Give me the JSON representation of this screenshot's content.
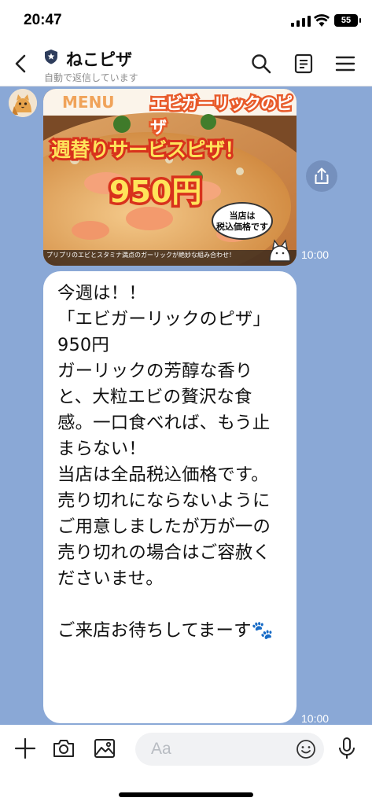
{
  "status_bar": {
    "time": "20:47",
    "battery": "55"
  },
  "header": {
    "title": "ねこピザ",
    "subtitle": "自動で返信しています",
    "icons": [
      "back-arrow",
      "shield",
      "search",
      "note",
      "menu"
    ]
  },
  "image_message": {
    "menu_label": "MENU",
    "banner_title": "エビガーリックのピザ",
    "headline": "週替りサービスピザ！",
    "price": "950円",
    "tax_note_line1": "当店は",
    "tax_note_line2": "税込価格です",
    "caption": "プリプリのエビとスタミナ満点のガーリックが絶妙な組み合わせ！",
    "time": "10:00"
  },
  "text_message": {
    "text": "今週は！！\n「エビガーリックのピザ」\n950円\nガーリックの芳醇な香りと、大粒エビの贅沢な食感。一口食べれば、もう止まらない！\n当店は全品税込価格です。\n売り切れにならないようにご用意しましたが万が一の売り切れの場合はご容赦くださいませ。\n\nご来店お待ちしてまーす🐾",
    "time": "10:00"
  },
  "input_bar": {
    "placeholder": "Aa"
  },
  "colors": {
    "chat_bg": "#8aa8d6",
    "accent_red": "#e8402a",
    "banner_orange": "#f07a2a"
  }
}
